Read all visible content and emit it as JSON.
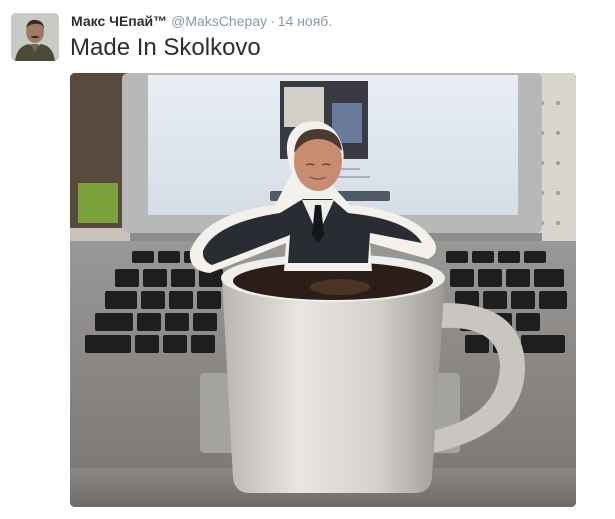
{
  "tweet": {
    "author_name": "Макс ЧЕпай™",
    "author_handle": "@MaksChepay",
    "separator": "·",
    "timestamp": "14 нояб.",
    "text": "Made In Skolkovo"
  },
  "avatar": {
    "icon": "user-avatar-photo"
  },
  "media": {
    "type": "photo",
    "icons": [
      "laptop",
      "keyboard",
      "mug",
      "paper-figure-cutout"
    ]
  },
  "colors": {
    "name": "#292f33",
    "secondary": "#8899a6",
    "text": "#292f33"
  }
}
